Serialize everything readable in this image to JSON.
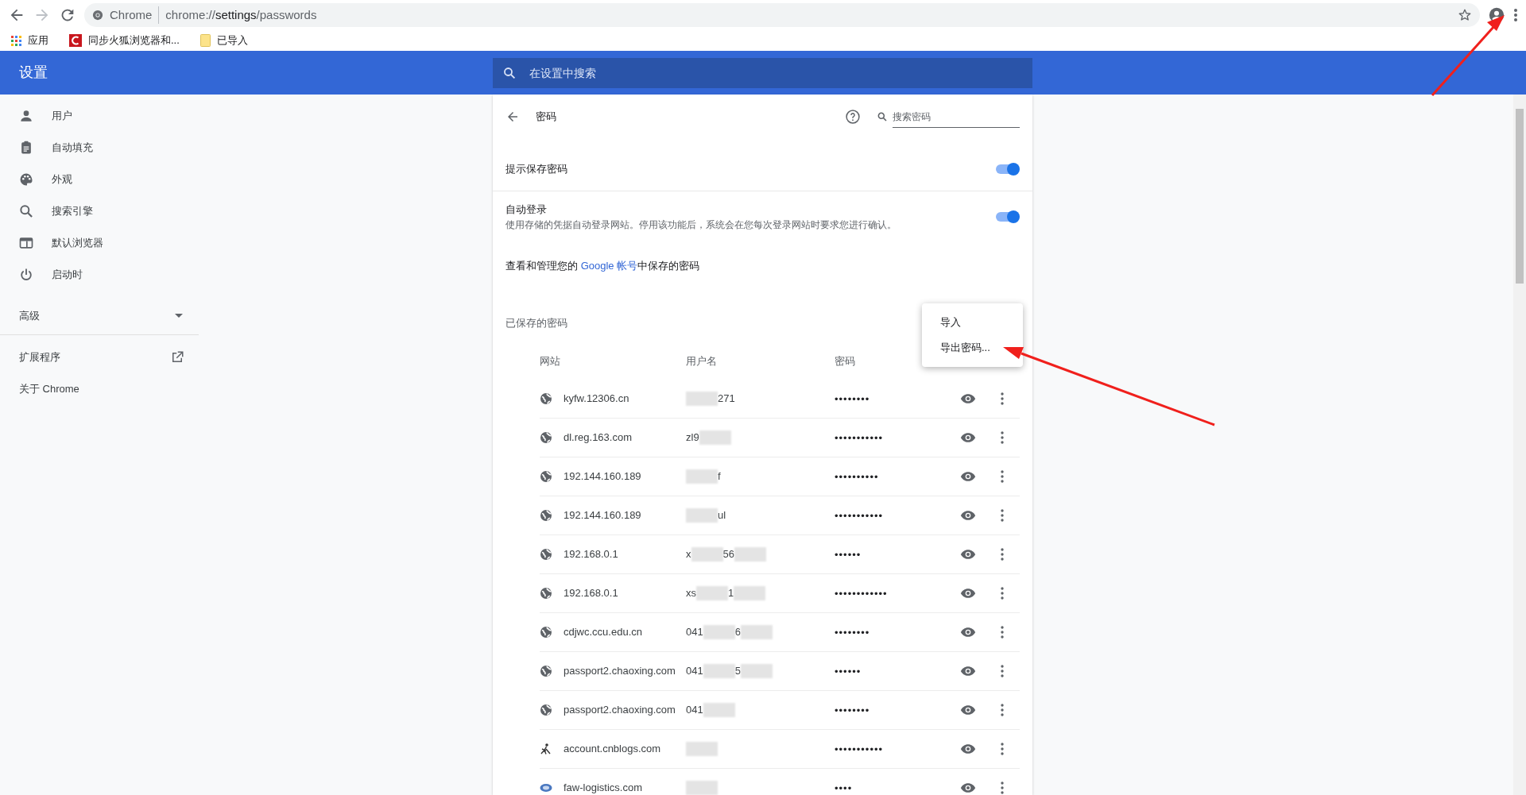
{
  "browser": {
    "tab_label": "Chrome",
    "url_host": "chrome://",
    "url_path": "settings",
    "url_rest": "/passwords",
    "bookmarks": [
      {
        "label": "应用",
        "kind": "apps"
      },
      {
        "label": "同步火狐浏览器和...",
        "kind": "red"
      },
      {
        "label": "已导入",
        "kind": "folder"
      }
    ]
  },
  "header": {
    "title": "设置",
    "search_placeholder": "在设置中搜索"
  },
  "sidebar": {
    "items": [
      {
        "label": "用户"
      },
      {
        "label": "自动填充"
      },
      {
        "label": "外观"
      },
      {
        "label": "搜索引擎"
      },
      {
        "label": "默认浏览器"
      },
      {
        "label": "启动时"
      }
    ],
    "advanced": {
      "label": "高级",
      "expanded": false
    },
    "extensions": "扩展程序",
    "about": "关于 Chrome"
  },
  "page": {
    "title": "密码",
    "search_placeholder": "搜索密码",
    "toggles": [
      {
        "label": "提示保存密码",
        "on": true
      },
      {
        "label": "自动登录",
        "description": "使用存储的凭据自动登录网站。停用该功能后，系统会在您每次登录网站时要求您进行确认。",
        "on": true
      }
    ],
    "account_line": {
      "before": "查看和管理您的 ",
      "link": "Google 帐号",
      "after": "中保存的密码"
    },
    "saved_title": "已保存的密码",
    "columns": [
      "网站",
      "用户名",
      "密码"
    ],
    "rows": [
      {
        "site": "kyfw.12306.cn",
        "kind": "globe",
        "username": [
          {
            "kind": "blur"
          },
          {
            "kind": "text",
            "text": "271"
          }
        ],
        "password": "••••••••"
      },
      {
        "site": "dl.reg.163.com",
        "kind": "globe",
        "username": [
          {
            "kind": "text",
            "text": "zl9"
          },
          {
            "kind": "blur"
          }
        ],
        "password": "•••••••••••"
      },
      {
        "site": "192.144.160.189",
        "kind": "globe",
        "username": [
          {
            "kind": "blur"
          },
          {
            "kind": "text",
            "text": "f"
          }
        ],
        "password": "••••••••••"
      },
      {
        "site": "192.144.160.189",
        "kind": "globe",
        "username": [
          {
            "kind": "blur"
          },
          {
            "kind": "text",
            "text": "ul"
          }
        ],
        "password": "•••••••••••"
      },
      {
        "site": "192.168.0.1",
        "kind": "globe",
        "username": [
          {
            "kind": "text",
            "text": "x"
          },
          {
            "kind": "blur"
          },
          {
            "kind": "text",
            "text": "56"
          },
          {
            "kind": "blur"
          }
        ],
        "password": "••••••"
      },
      {
        "site": "192.168.0.1",
        "kind": "globe",
        "username": [
          {
            "kind": "text",
            "text": "xs"
          },
          {
            "kind": "blur"
          },
          {
            "kind": "text",
            "text": "1"
          },
          {
            "kind": "blur"
          }
        ],
        "password": "••••••••••••"
      },
      {
        "site": "cdjwc.ccu.edu.cn",
        "kind": "globe",
        "username": [
          {
            "kind": "text",
            "text": "041"
          },
          {
            "kind": "blur"
          },
          {
            "kind": "text",
            "text": "6"
          },
          {
            "kind": "blur"
          }
        ],
        "password": "••••••••"
      },
      {
        "site": "passport2.chaoxing.com",
        "kind": "globe",
        "username": [
          {
            "kind": "text",
            "text": "041"
          },
          {
            "kind": "blur"
          },
          {
            "kind": "text",
            "text": "5"
          },
          {
            "kind": "blur"
          }
        ],
        "password": "••••••"
      },
      {
        "site": "passport2.chaoxing.com",
        "kind": "globe",
        "username": [
          {
            "kind": "text",
            "text": "041"
          },
          {
            "kind": "blur"
          }
        ],
        "password": "••••••••"
      },
      {
        "site": "account.cnblogs.com",
        "kind": "cnblogs",
        "username": [
          {
            "kind": "blur"
          }
        ],
        "password": "•••••••••••"
      },
      {
        "site": "faw-logistics.com",
        "kind": "faw",
        "username": [
          {
            "kind": "blur"
          }
        ],
        "password": "••••"
      }
    ],
    "menu": [
      "导入",
      "导出密码..."
    ]
  }
}
